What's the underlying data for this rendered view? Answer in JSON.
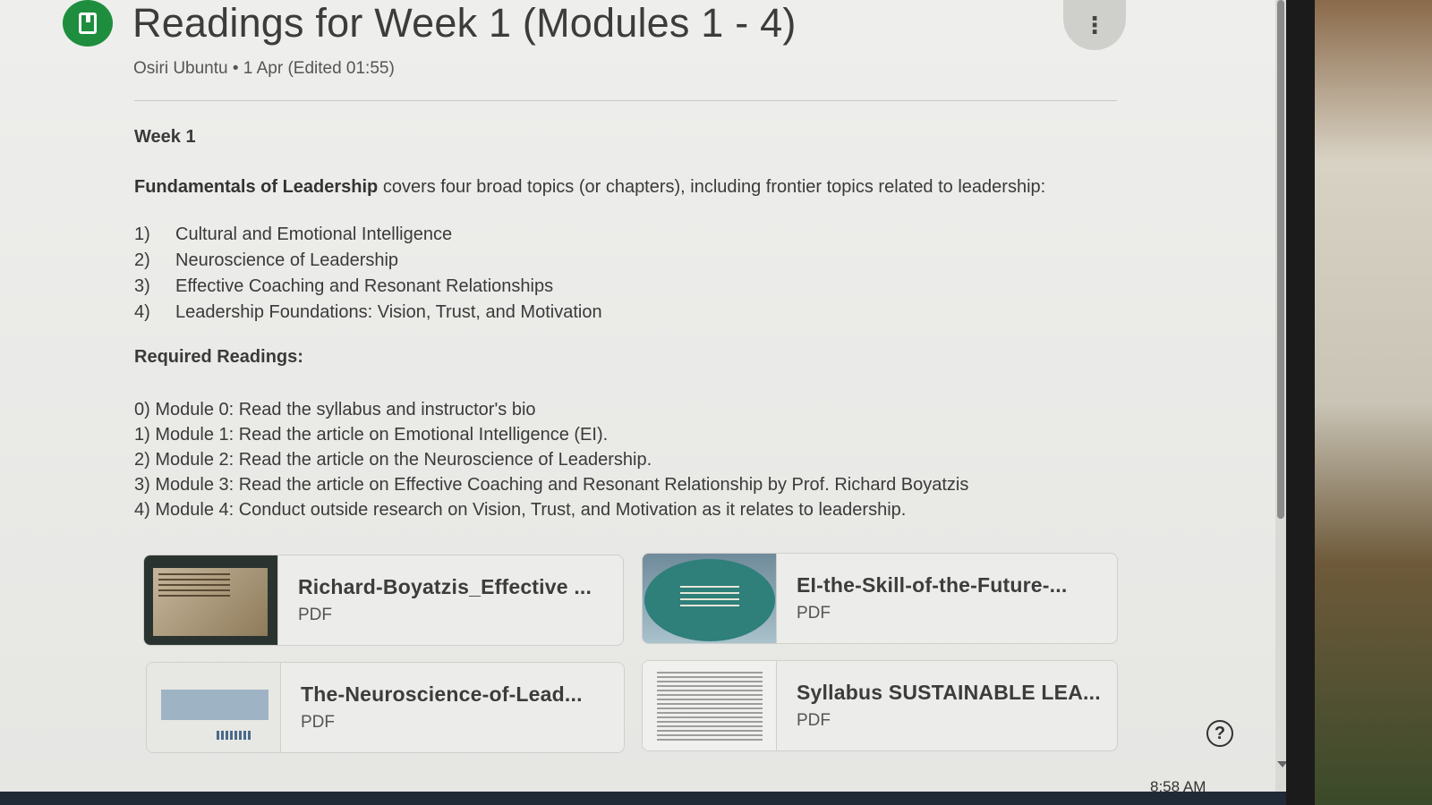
{
  "post": {
    "title": "Readings for Week 1 (Modules 1 - 4)",
    "meta": "Osiri Ubuntu • 1 Apr (Edited 01:55)",
    "more_icon": "⋮"
  },
  "body": {
    "week": "Week 1",
    "intro_bold": "Fundamentals of Leadership",
    "intro_rest": " covers four broad topics (or chapters), including frontier topics related to leadership:",
    "topics": [
      {
        "num": "1)",
        "text": "Cultural and Emotional Intelligence"
      },
      {
        "num": "2)",
        "text": "Neuroscience of Leadership"
      },
      {
        "num": "3)",
        "text": "Effective Coaching and Resonant Relationships"
      },
      {
        "num": "4)",
        "text": "Leadership Foundations: Vision, Trust, and Motivation"
      }
    ],
    "required_heading": "Required Readings:",
    "readings": [
      "0) Module 0: Read the syllabus and instructor's bio",
      "1) Module 1: Read the article on Emotional Intelligence (EI).",
      "2) Module 2: Read the article on the Neuroscience of Leadership.",
      "3) Module 3: Read the article on Effective Coaching and Resonant Relationship by Prof. Richard Boyatzis",
      "4) Module 4: Conduct outside research on Vision, Trust, and Motivation as it relates to leadership."
    ]
  },
  "attachments": [
    {
      "title": "Richard-Boyatzis_Effective ...",
      "type": "PDF"
    },
    {
      "title": "EI-the-Skill-of-the-Future-...",
      "type": "PDF"
    },
    {
      "title": "The-Neuroscience-of-Lead...",
      "type": "PDF"
    },
    {
      "title": "Syllabus SUSTAINABLE LEA...",
      "type": "PDF"
    }
  ],
  "help_icon": "?",
  "clock": "8:58 AM"
}
